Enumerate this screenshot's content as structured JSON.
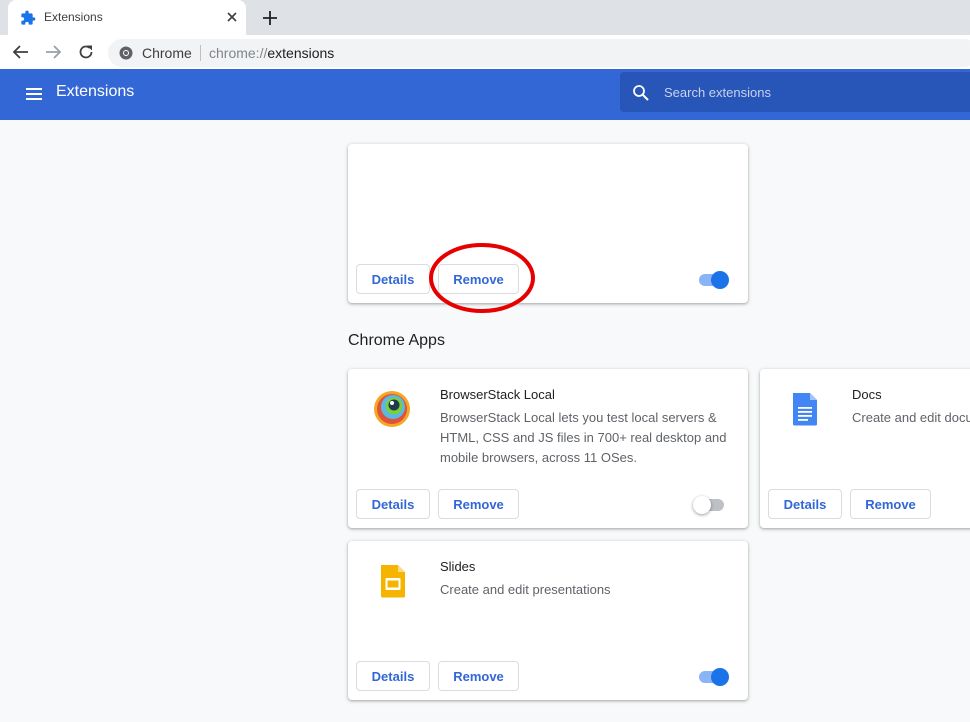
{
  "browser": {
    "tab_title": "Extensions",
    "omnibox_label": "Chrome",
    "url_scheme": "chrome://",
    "url_host": "extensions"
  },
  "header": {
    "title": "Extensions",
    "search_placeholder": "Search extensions",
    "color": "#3367d6"
  },
  "extensions": [
    {
      "name": "",
      "description": "",
      "details_label": "Details",
      "remove_label": "Remove",
      "enabled": true
    }
  ],
  "chrome_apps": {
    "title": "Chrome Apps",
    "items": [
      {
        "name": "BrowserStack Local",
        "description": "BrowserStack Local lets you test local servers & HTML, CSS and JS files in 700+ real desktop and mobile browsers, across 11 OSes.",
        "icon": "browserstack-icon",
        "details_label": "Details",
        "remove_label": "Remove",
        "enabled": false
      },
      {
        "name": "Docs",
        "description": "Create and edit documents",
        "icon": "docs-icon",
        "details_label": "Details",
        "remove_label": "Remove",
        "enabled": true
      },
      {
        "name": "Slides",
        "description": "Create and edit presentations",
        "icon": "slides-icon",
        "details_label": "Details",
        "remove_label": "Remove",
        "enabled": true
      }
    ]
  },
  "annotation": {
    "shape": "red-ellipse",
    "target": "remove-button",
    "color": "#e60000"
  }
}
